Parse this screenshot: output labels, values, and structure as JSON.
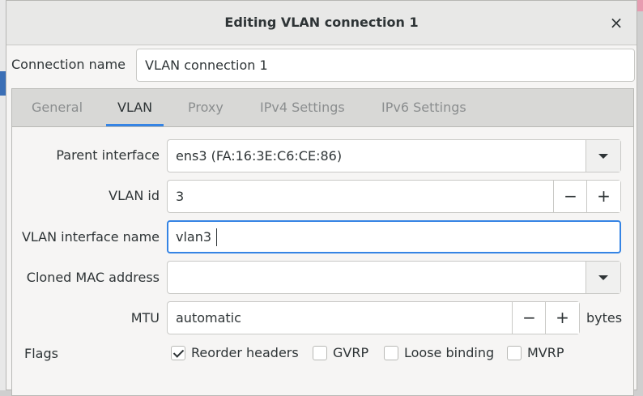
{
  "window": {
    "title": "Editing VLAN connection 1",
    "close_glyph": "×"
  },
  "connection": {
    "label": "Connection name",
    "value": "VLAN connection 1"
  },
  "tabs": [
    {
      "label": "General",
      "active": false
    },
    {
      "label": "VLAN",
      "active": true
    },
    {
      "label": "Proxy",
      "active": false
    },
    {
      "label": "IPv4 Settings",
      "active": false
    },
    {
      "label": "IPv6 Settings",
      "active": false
    }
  ],
  "vlan": {
    "parent_interface": {
      "label": "Parent interface",
      "value": "ens3 (FA:16:3E:C6:CE:86)"
    },
    "vlan_id": {
      "label": "VLAN id",
      "value": "3"
    },
    "interface_name": {
      "label": "VLAN interface name",
      "value": "vlan3"
    },
    "cloned_mac": {
      "label": "Cloned MAC address",
      "value": ""
    },
    "mtu": {
      "label": "MTU",
      "value": "automatic",
      "units": "bytes"
    },
    "spin": {
      "minus": "−",
      "plus": "+"
    },
    "flags": {
      "label": "Flags",
      "options": [
        {
          "label": "Reorder headers",
          "checked": true
        },
        {
          "label": "GVRP",
          "checked": false
        },
        {
          "label": "Loose binding",
          "checked": false
        },
        {
          "label": "MVRP",
          "checked": false
        }
      ]
    }
  },
  "colors": {
    "accent": "#3584e4",
    "dialog_bg": "#f6f5f4",
    "tabbar_bg": "#d8d8d6"
  }
}
